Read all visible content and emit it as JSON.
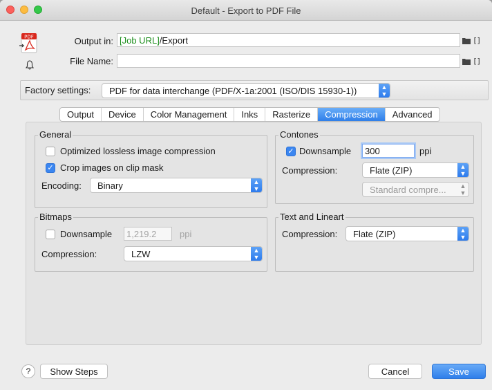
{
  "window": {
    "title": "Default - Export to PDF File"
  },
  "header": {
    "output_label": "Output in:",
    "output_value_var": "[Job URL]",
    "output_value_path": "/Export",
    "filename_label": "File Name:",
    "filename_value": "",
    "pdf_icon_text": "PDF"
  },
  "factory": {
    "label": "Factory settings:",
    "value": "PDF for data interchange (PDF/X-1a:2001 (ISO/DIS 15930-1))"
  },
  "tabs": [
    {
      "label": "Output",
      "active": false
    },
    {
      "label": "Device",
      "active": false
    },
    {
      "label": "Color Management",
      "active": false
    },
    {
      "label": "Inks",
      "active": false
    },
    {
      "label": "Rasterize",
      "active": false
    },
    {
      "label": "Compression",
      "active": true
    },
    {
      "label": "Advanced",
      "active": false
    }
  ],
  "general": {
    "title": "General",
    "optimized_label": "Optimized lossless image compression",
    "optimized_checked": false,
    "crop_label": "Crop images on clip mask",
    "crop_checked": true,
    "encoding_label": "Encoding:",
    "encoding_value": "Binary"
  },
  "contones": {
    "title": "Contones",
    "downsample_label": "Downsample",
    "downsample_checked": true,
    "downsample_value": "300",
    "unit": "ppi",
    "compression_label": "Compression:",
    "compression_value": "Flate (ZIP)",
    "quality_value": "Standard compre..."
  },
  "bitmaps": {
    "title": "Bitmaps",
    "downsample_label": "Downsample",
    "downsample_checked": false,
    "downsample_value": "1,219.2",
    "unit": "ppi",
    "compression_label": "Compression:",
    "compression_value": "LZW"
  },
  "text_lineart": {
    "title": "Text and Lineart",
    "compression_label": "Compression:",
    "compression_value": "Flate (ZIP)"
  },
  "footer": {
    "help": "?",
    "show_steps": "Show Steps",
    "cancel": "Cancel",
    "save": "Save"
  }
}
